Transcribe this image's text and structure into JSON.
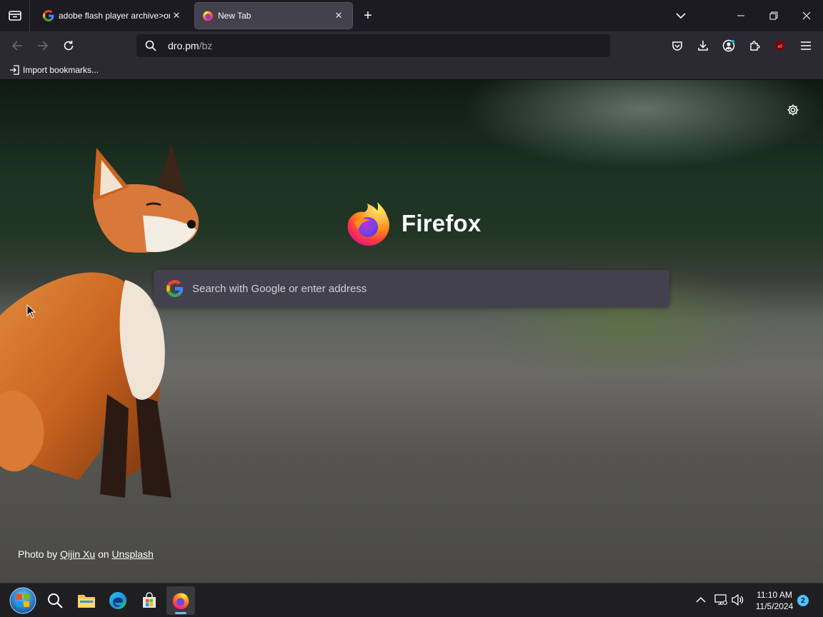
{
  "browser": {
    "tabs": [
      {
        "title": "adobe flash player archive>org",
        "favicon": "google-g-icon",
        "active": false
      },
      {
        "title": "New Tab",
        "favicon": "firefox-icon",
        "active": true
      }
    ],
    "url_host": "dro.pm",
    "url_path": "/bz",
    "bookmarks": [
      {
        "label": "Import bookmarks..."
      }
    ]
  },
  "newtab": {
    "wordmark": "Firefox",
    "search_placeholder": "Search with Google or enter address",
    "credit": {
      "prefix": "Photo by ",
      "author": "Qijin Xu",
      "middle": " on ",
      "site": "Unsplash"
    }
  },
  "taskbar": {
    "time": "11:10 AM",
    "date": "11/5/2024",
    "notification_count": "2"
  },
  "colors": {
    "toolbar": "#2b2a33",
    "tabstrip": "#1c1b22",
    "search_box": "#42414d",
    "accent": "#76b9ed"
  }
}
